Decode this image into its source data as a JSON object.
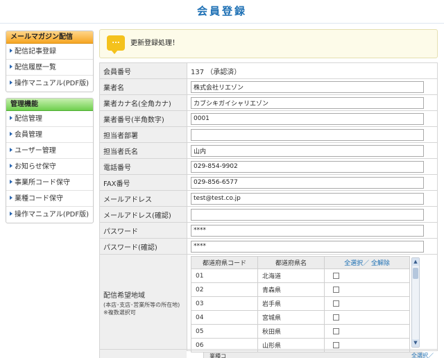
{
  "page_title": "会員登録",
  "sidebar": {
    "mailmag": {
      "heading": "メールマガジン配信",
      "items": [
        "配信記事登録",
        "配信履歴一覧",
        "操作マニュアル(PDF版)"
      ]
    },
    "admin": {
      "heading": "管理機能",
      "items": [
        "配信管理",
        "会員管理",
        "ユーザー管理",
        "お知らせ保守",
        "事業所コード保守",
        "業種コード保守",
        "操作マニュアル(PDF版)"
      ]
    }
  },
  "notice": {
    "icon_text": "...",
    "message": "更新登録処理！"
  },
  "form": {
    "member_no": {
      "label": "会員番号",
      "value": "137 （承認済）"
    },
    "company": {
      "label": "業者名",
      "value": "株式会社リエゾン"
    },
    "company_kana": {
      "label": "業者カナ名(全角カナ)",
      "value": "カブシキガイシャリエゾン"
    },
    "company_no": {
      "label": "業者番号(半角数字)",
      "value": "0001"
    },
    "dept": {
      "label": "担当者部署",
      "value": ""
    },
    "person": {
      "label": "担当者氏名",
      "value": "山内"
    },
    "phone": {
      "label": "電話番号",
      "value": "029-854-9902"
    },
    "fax": {
      "label": "FAX番号",
      "value": "029-856-6577"
    },
    "email": {
      "label": "メールアドレス",
      "value": "test@test.co.jp"
    },
    "email_confirm": {
      "label": "メールアドレス(確認)",
      "value": ""
    },
    "password": {
      "label": "パスワード",
      "value": "****"
    },
    "password_confirm": {
      "label": "パスワード(確認)",
      "value": "****"
    },
    "region": {
      "label": "配信希望地域",
      "sub1": "(本店･支店･営業所等の所在地)",
      "sub2": "※複数選択可",
      "col_code": "都道府県コード",
      "col_name": "都道府県名",
      "col_select": "全選択／ 全解除",
      "rows": [
        {
          "code": "01",
          "name": "北海道"
        },
        {
          "code": "02",
          "name": "青森県"
        },
        {
          "code": "03",
          "name": "岩手県"
        },
        {
          "code": "04",
          "name": "宮城県"
        },
        {
          "code": "05",
          "name": "秋田県"
        },
        {
          "code": "06",
          "name": "山形県"
        }
      ]
    },
    "partial_next": {
      "col_code": "業種コ",
      "col_select": "全選択／"
    }
  },
  "colors": {
    "title_blue": "#1c6fb4",
    "menu_orange": "#f6a623",
    "menu_green": "#6fcf4e",
    "notice_icon": "#f4c21c"
  },
  "icons": {
    "notice": "speech-bubble-icon",
    "menu_arrow": "triangle-right-icon",
    "scroll_up": "chevron-up-icon",
    "scroll_down": "chevron-down-icon"
  }
}
